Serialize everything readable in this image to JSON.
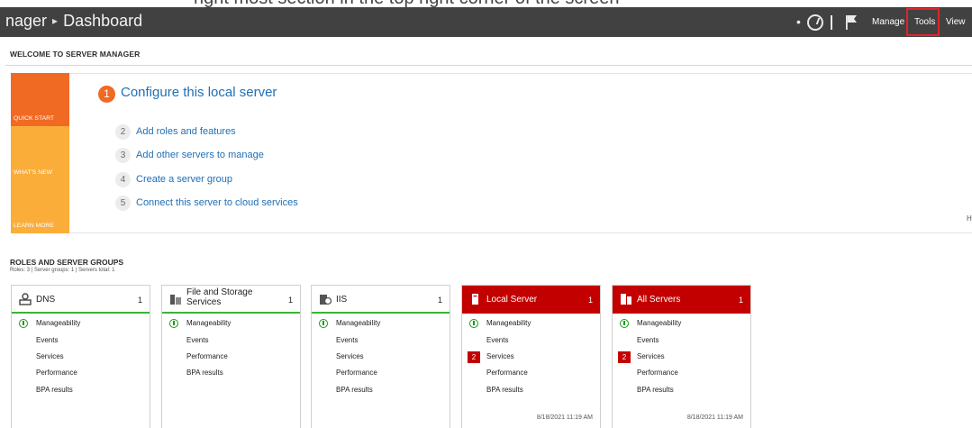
{
  "caption": "right most section in the top right corner of the screen",
  "titlebar": {
    "breadcrumb_app": "nager",
    "breadcrumb_page": "Dashboard",
    "menu": [
      "Manage",
      "Tools",
      "View"
    ]
  },
  "welcome": {
    "title": "WELCOME TO SERVER MANAGER",
    "tiles": [
      "QUICK START",
      "WHAT'S NEW",
      "LEARN MORE"
    ],
    "main_step": {
      "num": "1",
      "label": "Configure this local server"
    },
    "steps": [
      {
        "num": "2",
        "label": "Add roles and features"
      },
      {
        "num": "3",
        "label": "Add other servers to manage"
      },
      {
        "num": "4",
        "label": "Create a server group"
      },
      {
        "num": "5",
        "label": "Connect this server to cloud services"
      }
    ],
    "hide": "H"
  },
  "roles": {
    "title": "ROLES AND SERVER GROUPS",
    "subtitle": "Roles: 3  |  Server groups: 1  |  Servers total: 1",
    "cards": [
      {
        "title": "DNS",
        "count": "1",
        "rows": [
          "Manageability",
          "Events",
          "Services",
          "Performance",
          "BPA results"
        ]
      },
      {
        "title": "File and Storage Services",
        "count": "1",
        "rows": [
          "Manageability",
          "Events",
          "Performance",
          "BPA results"
        ]
      },
      {
        "title": "IIS",
        "count": "1",
        "rows": [
          "Manageability",
          "Events",
          "Services",
          "Performance",
          "BPA results"
        ]
      },
      {
        "title": "Local Server",
        "count": "1",
        "rows": [
          "Manageability",
          "Events",
          "Services",
          "Performance",
          "BPA results"
        ],
        "badge": "2",
        "timestamp": "8/18/2021 11:19 AM"
      },
      {
        "title": "All Servers",
        "count": "1",
        "rows": [
          "Manageability",
          "Events",
          "Services",
          "Performance",
          "BPA results"
        ],
        "badge": "2",
        "timestamp": "8/18/2021 11:19 AM"
      }
    ]
  },
  "colors": {
    "titlebar": "#414141",
    "accent_orange": "#f06a23",
    "tile_yellow": "#fbad3a",
    "alert_red": "#c30000",
    "ok_green": "#3ab336",
    "link_blue": "#1f6fb5"
  }
}
